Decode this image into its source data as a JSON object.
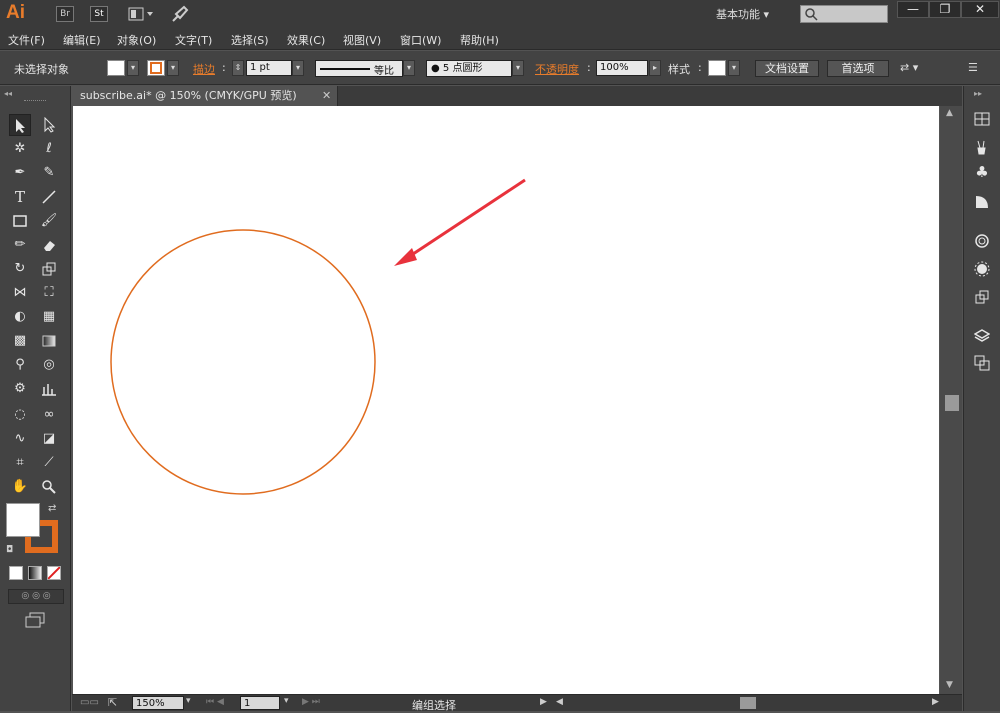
{
  "app": {
    "logo": "Ai",
    "bridge_label": "Br",
    "stock_label": "St",
    "workspace": "基本功能",
    "workspace_arrow": "▾"
  },
  "menu": [
    "文件(F)",
    "编辑(E)",
    "对象(O)",
    "文字(T)",
    "选择(S)",
    "效果(C)",
    "视图(V)",
    "窗口(W)",
    "帮助(H)"
  ],
  "control": {
    "selection_status": "未选择对象",
    "stroke_label": "描边",
    "stroke_weight": "1 pt",
    "stroke_profile": "等比",
    "brush": "5 点圆形",
    "opacity_label": "不透明度",
    "opacity_value": "100%",
    "style_label": "样式",
    "doc_setup_button": "文档设置",
    "preferences_button": "首选项",
    "colors": {
      "fill": "#ffffff",
      "stroke": "#e06c1f"
    }
  },
  "document": {
    "tab_title": "subscribe.ai* @ 150% (CMYK/GPU 预览)",
    "circle_color": "#e06c1f",
    "arrow_color": "#e8323c"
  },
  "status": {
    "zoom": "150%",
    "artboard": "1",
    "selection": "编组选择"
  }
}
